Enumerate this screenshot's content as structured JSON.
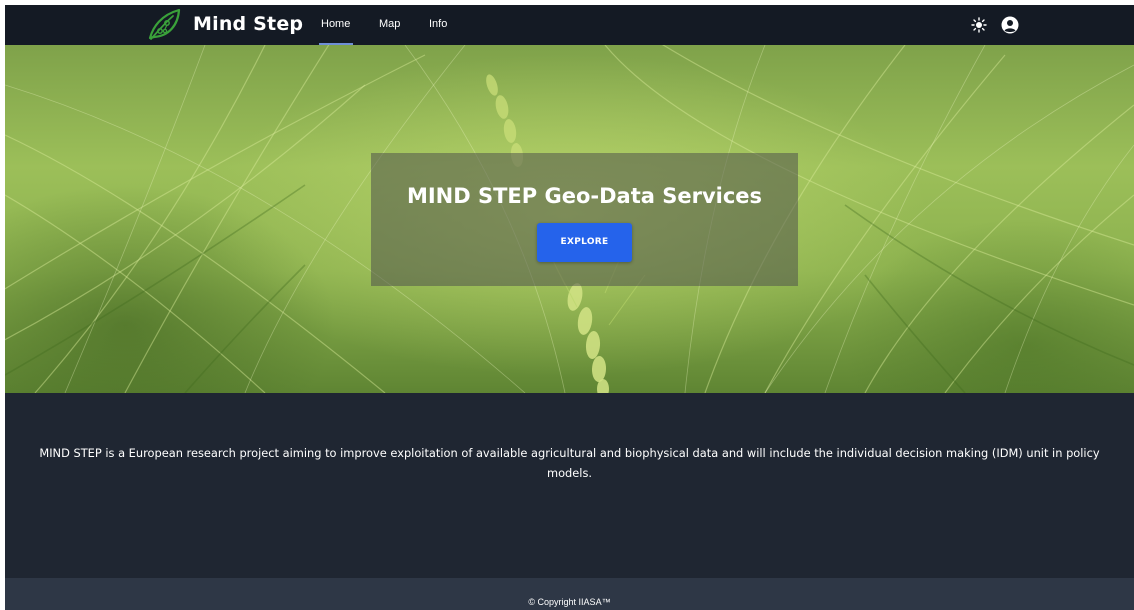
{
  "navbar": {
    "brand": "Mind Step",
    "logo_icon": "leaf-logo-icon",
    "links": [
      {
        "label": "Home",
        "active": true
      },
      {
        "label": "Map",
        "active": false
      },
      {
        "label": "Info",
        "active": false
      }
    ],
    "theme_icon": "sun-icon",
    "account_icon": "account-circle-icon"
  },
  "hero": {
    "title": "MIND STEP Geo-Data Services",
    "button_label": "EXPLORE"
  },
  "about": {
    "text": "MIND STEP is a European research project aiming to improve exploitation of available agricultural and biophysical data and will include the individual decision making (IDM) unit in policy models."
  },
  "footer": {
    "copyright": "© Copyright IIASA™"
  },
  "colors": {
    "navbar_bg": "#141a24",
    "body_bg": "#1f2632",
    "footer_bg": "#2e3746",
    "accent": "#2563eb",
    "logo_green": "#3aa13a"
  }
}
